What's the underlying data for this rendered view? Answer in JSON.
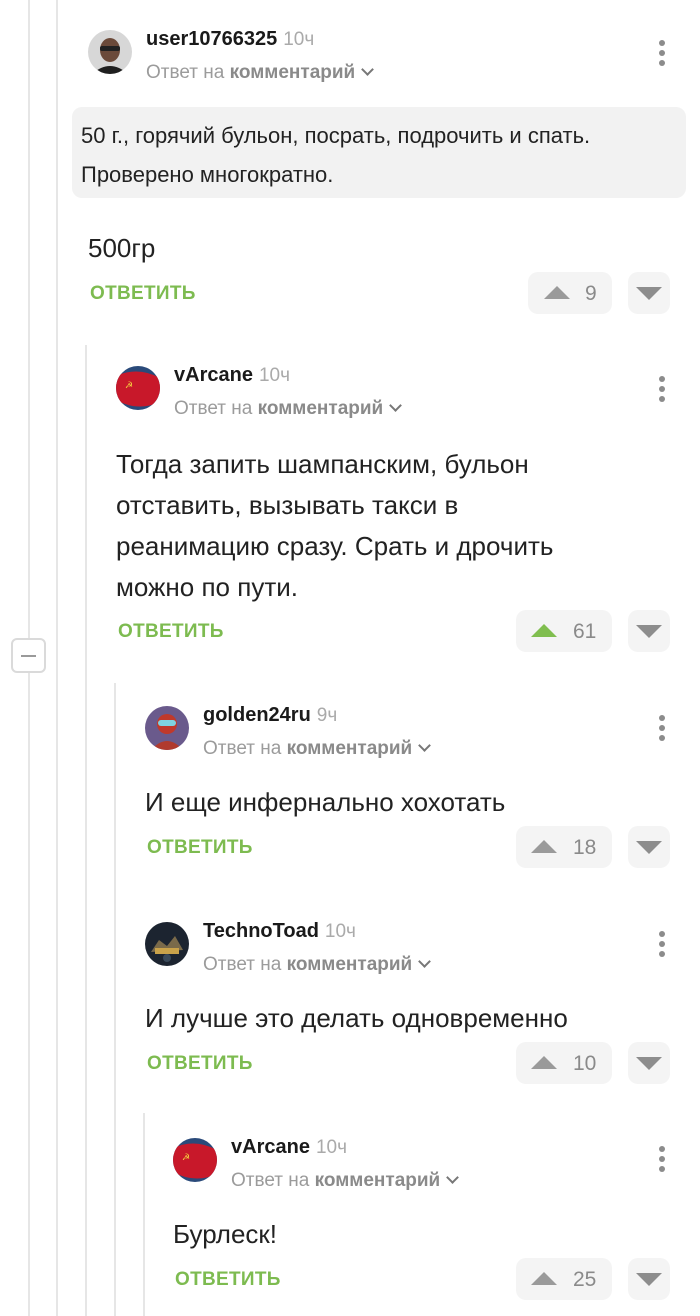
{
  "comments": [
    {
      "username": "user10766325",
      "time": "10ч",
      "reply_prefix": "Ответ на",
      "reply_target": "комментарий",
      "quote": [
        "50 г., горячий бульон, посрать, подрочить и спать.",
        "Проверено многократно."
      ],
      "text": [
        "500гр"
      ],
      "reply_label": "ОТВЕТИТЬ",
      "rating": "9",
      "upvoted": false
    },
    {
      "username": "vArcane",
      "time": "10ч",
      "reply_prefix": "Ответ на",
      "reply_target": "комментарий",
      "text": [
        "Тогда запить шампанским, бульон",
        "отставить, вызывать такси в",
        "реанимацию сразу. Срать и дрочить",
        "можно по пути."
      ],
      "reply_label": "ОТВЕТИТЬ",
      "rating": "61",
      "upvoted": true
    },
    {
      "username": "golden24ru",
      "time": "9ч",
      "reply_prefix": "Ответ на",
      "reply_target": "комментарий",
      "text": [
        "И еще инфернально хохотать"
      ],
      "reply_label": "ОТВЕТИТЬ",
      "rating": "18",
      "upvoted": false
    },
    {
      "username": "TechnoToad",
      "time": "10ч",
      "reply_prefix": "Ответ на",
      "reply_target": "комментарий",
      "text": [
        "И лучше это делать одновременно"
      ],
      "reply_label": "ОТВЕТИТЬ",
      "rating": "10",
      "upvoted": false
    },
    {
      "username": "vArcane",
      "time": "10ч",
      "reply_prefix": "Ответ на",
      "reply_target": "комментарий",
      "text": [
        "Бурлеск!"
      ],
      "reply_label": "ОТВЕТИТЬ",
      "rating": "25",
      "upvoted": false
    }
  ],
  "colors": {
    "accent_green": "#7dbb50",
    "upvote_active": "#80be4f",
    "muted": "#9b9b9b"
  },
  "icons": {
    "vote_up": "triangle-up-icon",
    "vote_down": "triangle-down-icon",
    "menu": "kebab-icon",
    "collapse": "minus-icon"
  }
}
